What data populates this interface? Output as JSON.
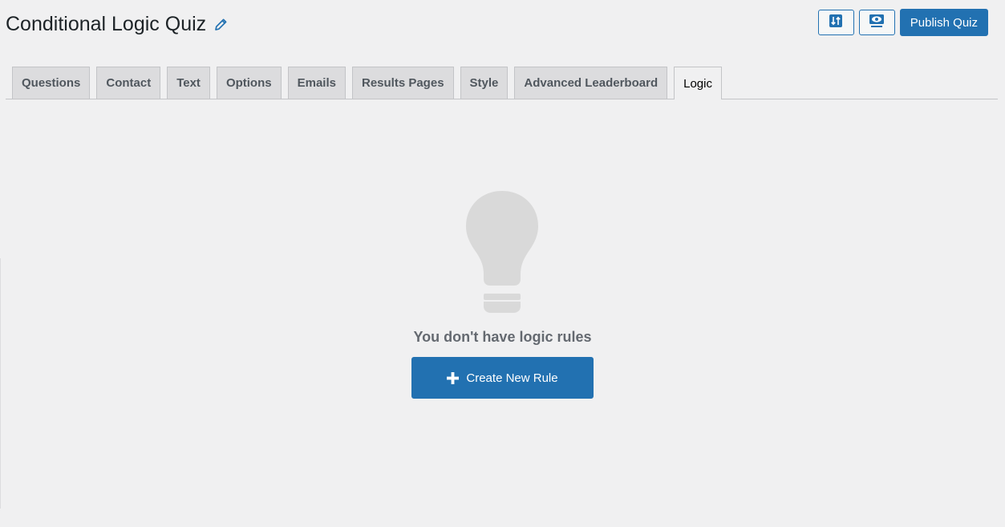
{
  "header": {
    "title": "Conditional Logic Quiz",
    "edit_icon": "pencil-icon",
    "actions": {
      "sort_icon": "sort-updown-icon",
      "preview_icon": "preview-eye-icon",
      "publish_label": "Publish Quiz"
    }
  },
  "tabs": [
    {
      "label": "Questions"
    },
    {
      "label": "Contact"
    },
    {
      "label": "Text"
    },
    {
      "label": "Options"
    },
    {
      "label": "Emails"
    },
    {
      "label": "Results Pages"
    },
    {
      "label": "Style"
    },
    {
      "label": "Advanced Leaderboard"
    },
    {
      "label": "Logic",
      "active": true
    }
  ],
  "empty_state": {
    "icon": "lightbulb-icon",
    "message": "You don't have logic rules",
    "create_label": "Create New Rule",
    "create_icon": "plus-icon"
  },
  "colors": {
    "accent": "#2271b1",
    "background": "#f0f0f1",
    "tab_inactive": "#dcdcde",
    "bulb": "#d9d9d9"
  }
}
